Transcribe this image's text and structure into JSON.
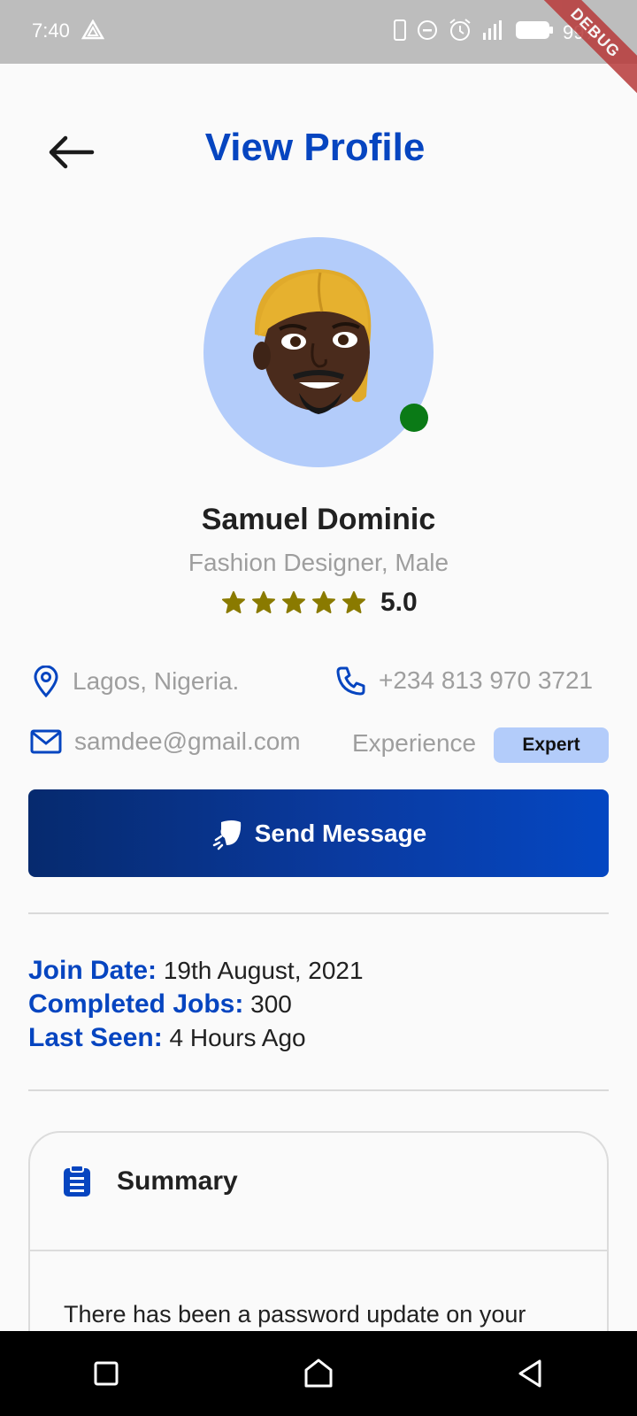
{
  "status_bar": {
    "time": "7:40",
    "battery": "99%",
    "debug": "DEBUG"
  },
  "header": {
    "title": "View Profile"
  },
  "profile": {
    "name": "Samuel Dominic",
    "role": "Fashion Designer, Male",
    "rating": "5.0",
    "stars": 5,
    "online": true
  },
  "info": {
    "location": "Lagos, Nigeria.",
    "phone": "+234 813 970 3721",
    "email": "samdee@gmail.com",
    "experience_label": "Experience",
    "experience_level": "Expert"
  },
  "actions": {
    "send_message": "Send Message"
  },
  "meta": {
    "join_date_label": "Join Date:",
    "join_date": "19th August, 2021",
    "completed_jobs_label": "Completed Jobs:",
    "completed_jobs": "300",
    "last_seen_label": "Last Seen:",
    "last_seen": "4 Hours Ago"
  },
  "summary": {
    "title": "Summary",
    "body": "There has been a password update on your"
  },
  "colors": {
    "accent": "#0645c0",
    "avatar_bg": "#b3ccfa",
    "online": "#0a7a16",
    "star": "#8a7a00"
  }
}
